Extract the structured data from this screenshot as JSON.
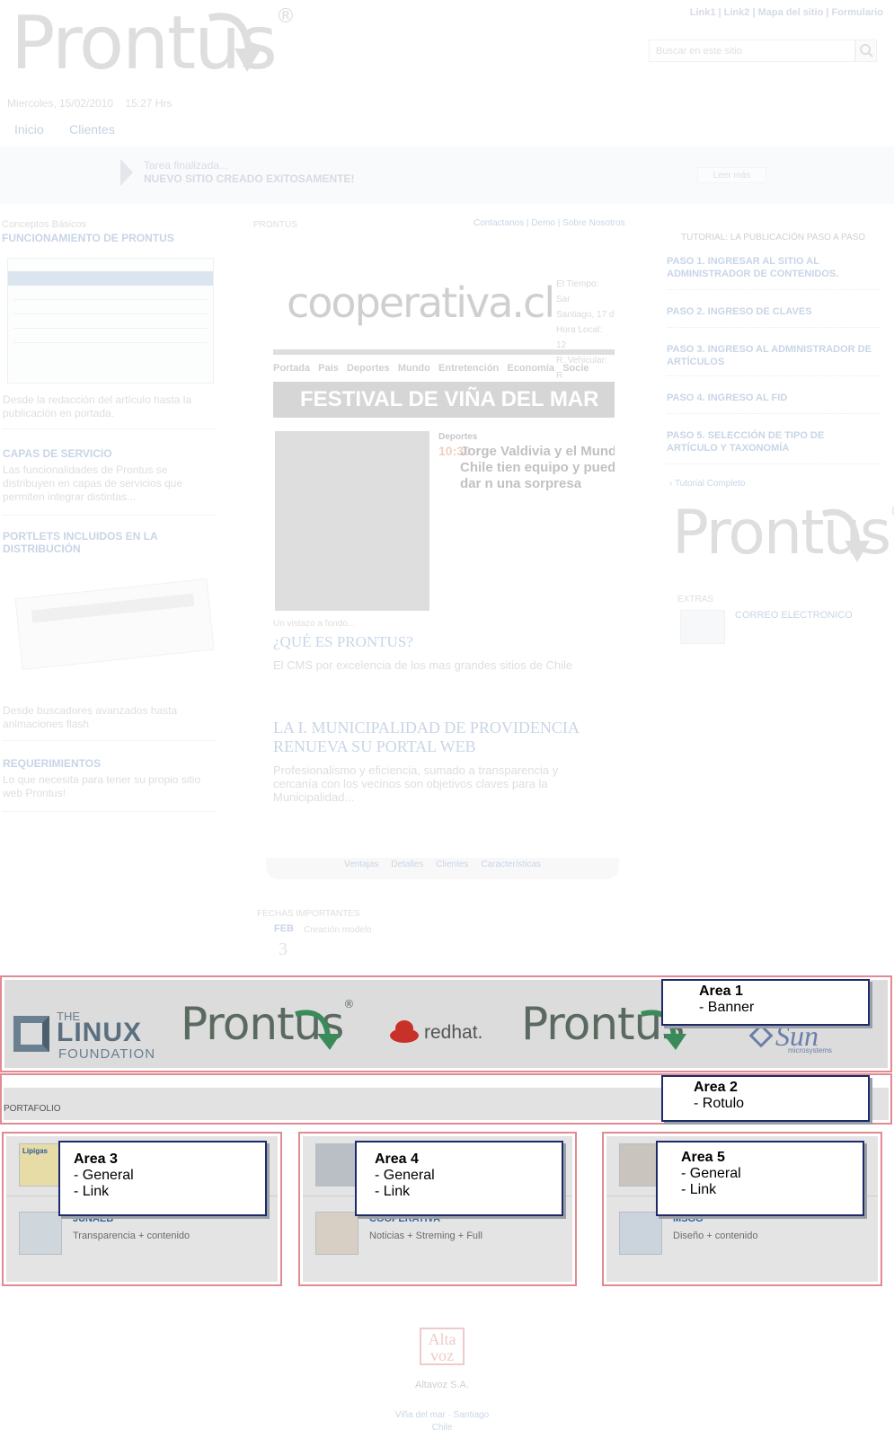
{
  "header": {
    "logo_word": "Prontus",
    "logo_reg": "®",
    "top_links": [
      "Link1",
      "Link2",
      "Mapa del sitio",
      "Formulario"
    ],
    "search_placeholder": "Buscar en este sitio",
    "date_text": "Miercoles, 15/02/2010",
    "time_text": "15:27 Hrs",
    "nav": [
      "Inicio",
      "Clientes"
    ]
  },
  "notice": {
    "line1": "Tarea finalizada...",
    "line2": "NUEVO SITIO CREADO EXITOSAMENTE!",
    "button": "Leer más"
  },
  "left_col": {
    "eyebrow": "Conceptos Básicos",
    "title1": "FUNCIONAMIENTO DE PRONTUS",
    "text1": "Desde la redacción del artículo hasta la publicación en portada.",
    "title2": "CAPAS DE SERVICIO",
    "text2": "Las funcionalidades de Prontus se distribuyen en capas de servicios que permiten integrar distintas...",
    "title3": "PORTLETS INCLUIDOS EN LA DISTRIBUCIÓN",
    "text3": "Desde buscadores avanzados hasta animaciones flash",
    "title4": "REQUERIMIENTOS",
    "text4": "Lo que necesita para tener su propio sitio web Prontus!"
  },
  "center_col": {
    "breadcrumb": "PRONTUS",
    "links": [
      "Contactanos",
      "Demo",
      "Sobre Nosotros"
    ],
    "coop_logo": "cooperativa.cl",
    "coop_info": [
      "El Tiempo: Sar",
      "Santiago, 17 d",
      "Hora Local: 12",
      "R. Vehicular: R"
    ],
    "coop_nav": [
      "Portada",
      "País",
      "Deportes",
      "Mundo",
      "Entretención",
      "Economía",
      "Socie"
    ],
    "coop_banner": "FESTIVAL DE VIÑA DEL MAR",
    "coop_section": "Deportes",
    "coop_time": "10:30",
    "coop_headline": "Jorge Valdivia y el Mundial: Chile tien equipo y puede dar n una sorpresa",
    "caption": "Un vistazo a fondo...",
    "q_title": "¿QUÉ ES PRONTUS?",
    "q_text": "El CMS por excelencia de los mas grandes sitios de Chile",
    "news_title": "LA I. MUNICIPALIDAD DE PROVIDENCIA RENUEVA SU PORTAL WEB",
    "news_text": "Profesionalismo y eficiencia, sumado a transparencia y cercanía con los vecinos son objetivos claves para la Municipalidad...",
    "tabs": [
      "Ventajas",
      "Detalles",
      "Clientes",
      "Características"
    ],
    "dates_title": "FECHAS IMPORTANTES",
    "date_month": "FEB",
    "date_day": "3",
    "date_text": "Creación modelo"
  },
  "right_col": {
    "title": "TUTORIAL: LA PUBLICACIÓN PASO A PASO",
    "steps": [
      "PASO 1. INGRESAR AL SITIO AL ADMINISTRADOR DE CONTENIDOS.",
      "PASO 2. INGRESO DE CLAVES",
      "PASO 3. INGRESO AL ADMINISTRADOR DE ARTÍCULOS",
      "PASO 4. INGRESO AL FID",
      "PASO 5. SELECCIÓN DE TIPO DE ARTÍCULO Y TAXONOMÍA"
    ],
    "tutorial_link": "Tutorial Completo",
    "extras_label": "EXTRAS",
    "extras_item": "CORREO ELECTRONICO"
  },
  "area1": {
    "callout_title": "Area 1",
    "callout_item": "- Banner",
    "linux_the": "THE",
    "linux_main": "LINUX",
    "linux_foundation": "FOUNDATION",
    "prontus": "Prontus",
    "reg": "®",
    "redhat": "redhat.",
    "sun": "Sun",
    "sun_sub": "microsystems"
  },
  "area2": {
    "callout_title": "Area 2",
    "callout_item": "- Rotulo",
    "label": "PORTAFOLIO"
  },
  "areas": [
    {
      "callout_title": "Area 3",
      "items": [
        "- General",
        "- Link"
      ],
      "card_title": "JUNAEB",
      "card_sub": "Transparencia + contenido",
      "thumb_top": "Lipigas"
    },
    {
      "callout_title": "Area 4",
      "items": [
        "- General",
        "- Link"
      ],
      "card_title": "COOPERATIVA",
      "card_sub": "Noticias + Streming + Full",
      "thumb_top": ""
    },
    {
      "callout_title": "Area 5",
      "items": [
        "- General",
        "- Link"
      ],
      "card_title": "MSGG",
      "card_sub": "Diseño + contenido",
      "thumb_top": ""
    }
  ],
  "footer": {
    "logo_top": "Alta",
    "logo_bottom": "voz",
    "company": "Altavoz S.A.",
    "address": "Viña del mar · Santiago",
    "country": "Chile"
  },
  "colors": {
    "frame": "#e28a92",
    "callout_border": "#1f2a6b",
    "link_blue": "#3a6aa6"
  }
}
